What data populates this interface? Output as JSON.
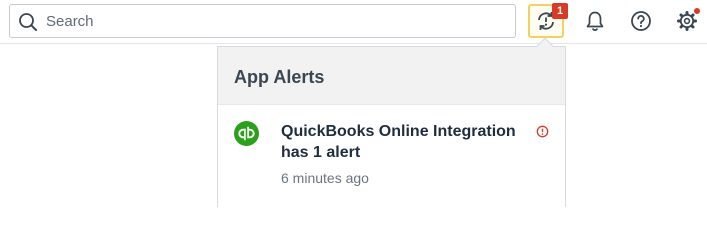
{
  "topbar": {
    "search": {
      "placeholder": "Search",
      "value": ""
    },
    "icons": {
      "search": "search-icon",
      "sync": "sync-alert-icon",
      "bell": "bell-icon",
      "help": "help-circle-icon",
      "gear": "gear-icon"
    },
    "sync_badge_count": "1",
    "colors": {
      "badge": "#d93a26",
      "active_border": "#f2d15f"
    }
  },
  "alerts_panel": {
    "title": "App Alerts",
    "items": [
      {
        "app_icon": "quickbooks-logo-icon",
        "title": "QuickBooks Online Integration has 1 alert",
        "time": "6 minutes ago",
        "status_icon": "warning-circle-icon"
      }
    ],
    "colors": {
      "header_bg": "#f2f2f2",
      "qb_green": "#2ca01c",
      "warning": "#d93a26"
    }
  }
}
